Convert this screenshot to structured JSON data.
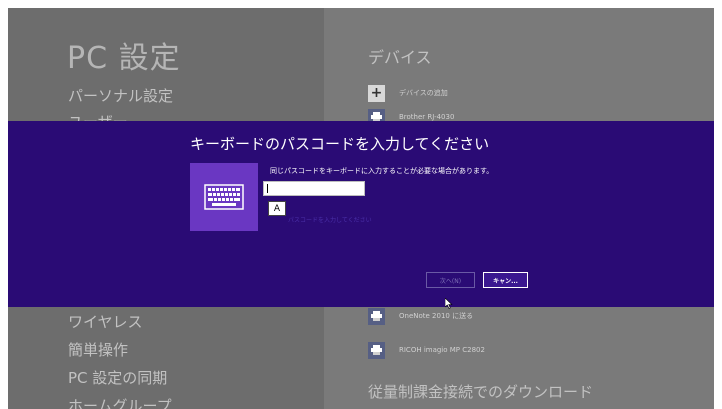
{
  "settings": {
    "title": "PC 設定",
    "left_items_top": [
      "パーソナル設定",
      "ユーザー"
    ],
    "left_items_bottom": [
      "ワイヤレス",
      "簡単操作",
      "PC 設定の同期",
      "ホームグループ"
    ]
  },
  "devices": {
    "heading": "デバイス",
    "add_label": "デバイスの追加",
    "items_top": [
      "Brother RJ-4030"
    ],
    "items_bottom": [
      "OneNote 2010 に送る",
      "RICOH imagio MP C2802"
    ],
    "metered_heading": "従量制課金接続でのダウンロード"
  },
  "dialog": {
    "title": "キーボードのパスコードを入力してください",
    "instruction": "同じパスコードをキーボードに入力することが必要な場合があります。",
    "input_value": "",
    "ime_mode": "A",
    "placeholder_hint": "パスコードを入力してください",
    "next_label": "次へ(N)",
    "cancel_label": "キャン..."
  },
  "colors": {
    "dialog_bg": "#2a0b75",
    "tile_bg": "#6a37c2",
    "overlay_left": "#6d6d6d",
    "overlay_right": "#7a7a7a"
  },
  "icons": {
    "keyboard": "keyboard-icon",
    "add": "plus-icon",
    "printer": "printer-icon",
    "cursor": "mouse-pointer-icon"
  }
}
